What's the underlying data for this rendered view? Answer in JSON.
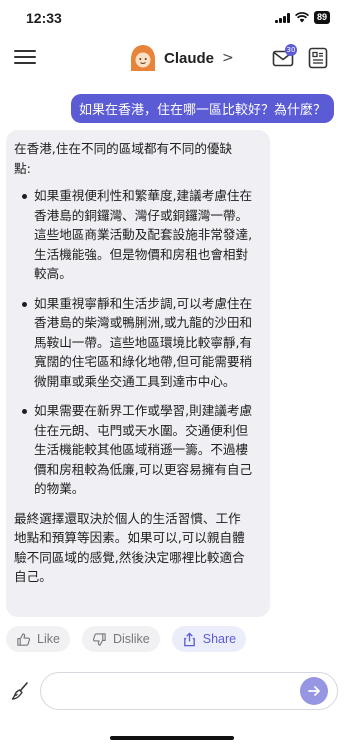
{
  "status_bar": {
    "time": "12:33",
    "battery": "89"
  },
  "header": {
    "model_name": "Claude",
    "chevron": ">",
    "mail_badge": "30",
    "icons": [
      "menu-icon",
      "claude-avatar-icon",
      "mail-icon",
      "document-icon"
    ]
  },
  "conversation": {
    "user_message": "如果在香港，住在哪一區比較好？為什麼？",
    "assistant": {
      "intro": "在香港,住在不同的區域都有不同的優缺點:",
      "bullets": [
        "如果重視便利性和繁華度,建議考慮住在香港島的銅鑼灣、灣仔或銅鑼灣一帶。這些地區商業活動及配套設施非常發達,生活機能強。但是物價和房租也會相對較高。",
        "如果重視寧靜和生活步調,可以考慮住在香港島的柴灣或鴨脷洲,或九龍的沙田和馬鞍山一帶。這些地區環境比較寧靜,有寬闊的住宅區和綠化地帶,但可能需要稍微開車或乘坐交通工具到達市中心。",
        "如果需要在新界工作或學習,則建議考慮住在元朗、屯門或天水圍。交通便利但生活機能較其他區域稍遜一籌。不過樓價和房租較為低廉,可以更容易擁有自己的物業。"
      ],
      "outro": "最終選擇還取決於個人的生活習慣、工作地點和預算等因素。如果可以,可以親自體驗不同區域的感覺,然後決定哪裡比較適合自己。"
    }
  },
  "feedback": {
    "like_label": "Like",
    "dislike_label": "Dislike",
    "share_label": "Share"
  },
  "composer": {
    "placeholder": "",
    "value": ""
  },
  "colors": {
    "accent": "#5b5bd6",
    "assistant_bg": "#efeff4",
    "send_button": "#9696e3",
    "avatar": "#e8833a"
  }
}
